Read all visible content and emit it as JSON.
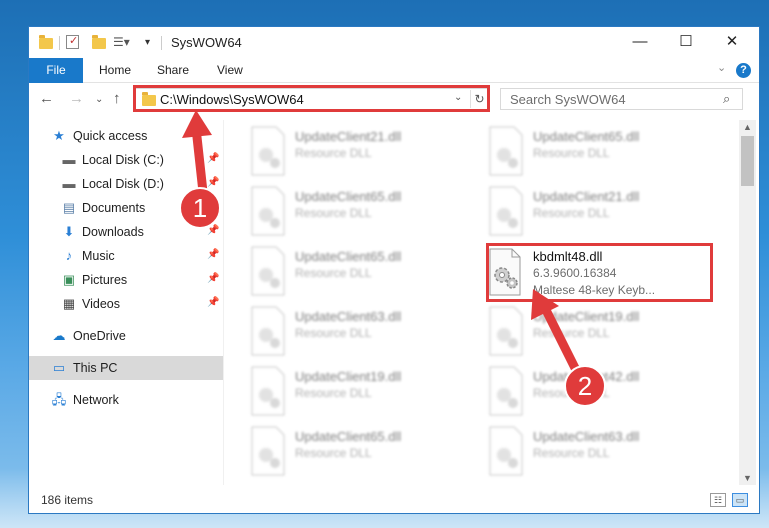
{
  "window": {
    "title": "SysWOW64",
    "minimize_icon": "minimize-icon",
    "maximize_icon": "maximize-icon",
    "close_icon": "close-icon"
  },
  "ribbon": {
    "tabs": [
      "File",
      "Home",
      "Share",
      "View"
    ],
    "help_label": "?"
  },
  "nav": {
    "address": "C:\\Windows\\SysWOW64",
    "search_placeholder": "Search SysWOW64"
  },
  "sidebar": {
    "items": [
      {
        "label": "Quick access",
        "icon": "star-icon"
      },
      {
        "label": "Local Disk (C:)",
        "icon": "drive-icon"
      },
      {
        "label": "Local Disk (D:)",
        "icon": "drive-icon"
      },
      {
        "label": "Documents",
        "icon": "documents-icon"
      },
      {
        "label": "Downloads",
        "icon": "download-icon"
      },
      {
        "label": "Music",
        "icon": "music-icon"
      },
      {
        "label": "Pictures",
        "icon": "pictures-icon"
      },
      {
        "label": "Videos",
        "icon": "videos-icon"
      },
      {
        "label": "OneDrive",
        "icon": "cloud-icon"
      },
      {
        "label": "This PC",
        "icon": "computer-icon"
      },
      {
        "label": "Network",
        "icon": "network-icon"
      }
    ]
  },
  "files": [
    {
      "name": "UpdateClient21.dll",
      "type": "Resource DLL"
    },
    {
      "name": "UpdateClient65.dll",
      "type": "Resource DLL"
    },
    {
      "name": "UpdateClient65.dll",
      "type": "Resource DLL"
    },
    {
      "name": "UpdateClient21.dll",
      "type": "Resource DLL"
    },
    {
      "name": "UpdateClient65.dll",
      "type": "Resource DLL"
    },
    {
      "name": "kbdmlt48.dll",
      "version": "6.3.9600.16384",
      "description": "Maltese 48-key Keyb..."
    },
    {
      "name": "UpdateClient63.dll",
      "type": "Resource DLL"
    },
    {
      "name": "UpdateClient19.dll",
      "type": "Resource DLL"
    },
    {
      "name": "UpdateClient19.dll",
      "type": "Resource DLL"
    },
    {
      "name": "UpdateClient42.dll",
      "type": "Resource DLL"
    },
    {
      "name": "UpdateClient65.dll",
      "type": "Resource DLL"
    },
    {
      "name": "UpdateClient63.dll",
      "type": "Resource DLL"
    }
  ],
  "status": {
    "item_count": "186 items"
  },
  "annotations": {
    "step1": "1",
    "step2": "2",
    "color": "#e03b3b"
  }
}
